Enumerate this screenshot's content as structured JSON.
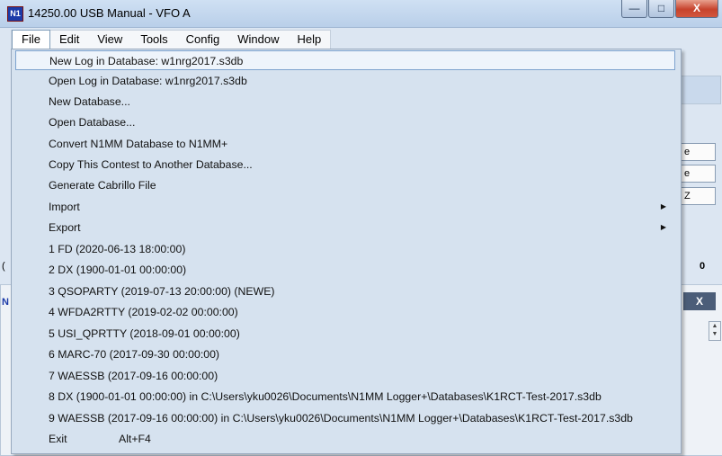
{
  "window": {
    "title": "14250.00 USB Manual - VFO A",
    "icon_text": "N1",
    "minimize": "—",
    "maximize": "□",
    "close": "X"
  },
  "menubar": [
    "File",
    "Edit",
    "View",
    "Tools",
    "Config",
    "Window",
    "Help"
  ],
  "background": {
    "btn1": "e",
    "btn2": "e",
    "btn3": "Z",
    "counter": "0",
    "sub_close": "X",
    "scroll_up": "▲",
    "scroll_down": "▼",
    "left_fragment_1": "(",
    "left_fragment_2": "N"
  },
  "file_menu": {
    "items": [
      {
        "label": "New Log in Database: w1nrg2017.s3db",
        "highlighted": true
      },
      {
        "label": "Open Log in Database: w1nrg2017.s3db"
      },
      {
        "label": "New Database..."
      },
      {
        "label": "Open Database..."
      },
      {
        "label": "Convert N1MM Database to N1MM+"
      },
      {
        "label": "Copy This Contest to Another Database..."
      },
      {
        "label": "Generate Cabrillo File"
      },
      {
        "label": "Import",
        "submenu": true
      },
      {
        "label": "Export",
        "submenu": true
      },
      {
        "label": "1 FD (2020-06-13 18:00:00)"
      },
      {
        "label": "2 DX (1900-01-01 00:00:00)"
      },
      {
        "label": "3 QSOPARTY (2019-07-13 20:00:00) (NEWE)"
      },
      {
        "label": "4 WFDA2RTTY (2019-02-02 00:00:00)"
      },
      {
        "label": "5 USI_QPRTTY (2018-09-01 00:00:00)"
      },
      {
        "label": "6 MARC-70 (2017-09-30 00:00:00)"
      },
      {
        "label": "7 WAESSB (2017-09-16 00:00:00)"
      },
      {
        "label": "8 DX (1900-01-01 00:00:00) in C:\\Users\\yku0026\\Documents\\N1MM Logger+\\Databases\\K1RCT-Test-2017.s3db"
      },
      {
        "label": "9 WAESSB (2017-09-16 00:00:00) in C:\\Users\\yku0026\\Documents\\N1MM Logger+\\Databases\\K1RCT-Test-2017.s3db"
      },
      {
        "label": "Exit",
        "shortcut": "Alt+F4"
      }
    ],
    "submenu_arrow": "▶"
  }
}
